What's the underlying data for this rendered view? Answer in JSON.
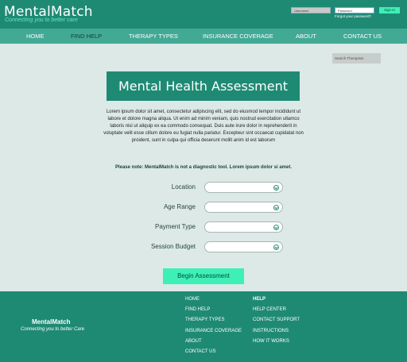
{
  "header": {
    "logo_title": "MentalMatch",
    "logo_tagline": "Connecting you to better care",
    "username_placeholder": "Username",
    "password_placeholder": "Password",
    "forgot_password": "Forgot your password?",
    "sign_in": "Sign In"
  },
  "nav": {
    "items": [
      "HOME",
      "FIND HELP",
      "THERAPY TYPES",
      "INSURANCE COVERAGE",
      "ABOUT",
      "CONTACT US"
    ],
    "active": "FIND HELP"
  },
  "search": {
    "placeholder": "Search Therapists"
  },
  "main": {
    "title": "Mental Health Assessment",
    "intro": "Lorem ipsum dolor sit amet, consectetur adipiscing elit, sed do eiusmod tempor incididunt ut labore et dolore magna aliqua. Ut enim ad minim veniam, quis nostrud exercitation ullamco laboris nisi ut aliquip ex ea commodo consequat. Duis aute irure dolor in reprehenderit in voluptate velit esse cillum dolore eu fugiat nulla pariatur. Excepteur sint occaecat cupidatat non proident, sunt in culpa qui officia deserunt mollit anim id est laborum",
    "note": "Please note: MentalMatch is not a diagnostic tool. Lorem ipsum dolor si amet.",
    "fields": [
      {
        "label": "Location",
        "value": ""
      },
      {
        "label": "Age Range",
        "value": ""
      },
      {
        "label": "Payment Type",
        "value": ""
      },
      {
        "label": "Session Budget",
        "value": ""
      }
    ],
    "submit": "Begin Assessment"
  },
  "footer": {
    "brand": "MentalMatch",
    "tagline": "Connecting you to better Care",
    "nav_links": [
      "HOME",
      "FIND HELP",
      "THERAPY TYPES",
      "INSURANCE COVERAGE",
      "ABOUT",
      "CONTACT US"
    ],
    "help_heading": "HELP",
    "help_links": [
      "HELP CENTER",
      "CONTACT SUPPORT",
      "INSTRUCTIONS",
      "HOW IT WORKS"
    ]
  },
  "colors": {
    "primary": "#1f8a74",
    "nav": "#42a995",
    "accent": "#3df0b6",
    "background": "#dce9e7"
  }
}
